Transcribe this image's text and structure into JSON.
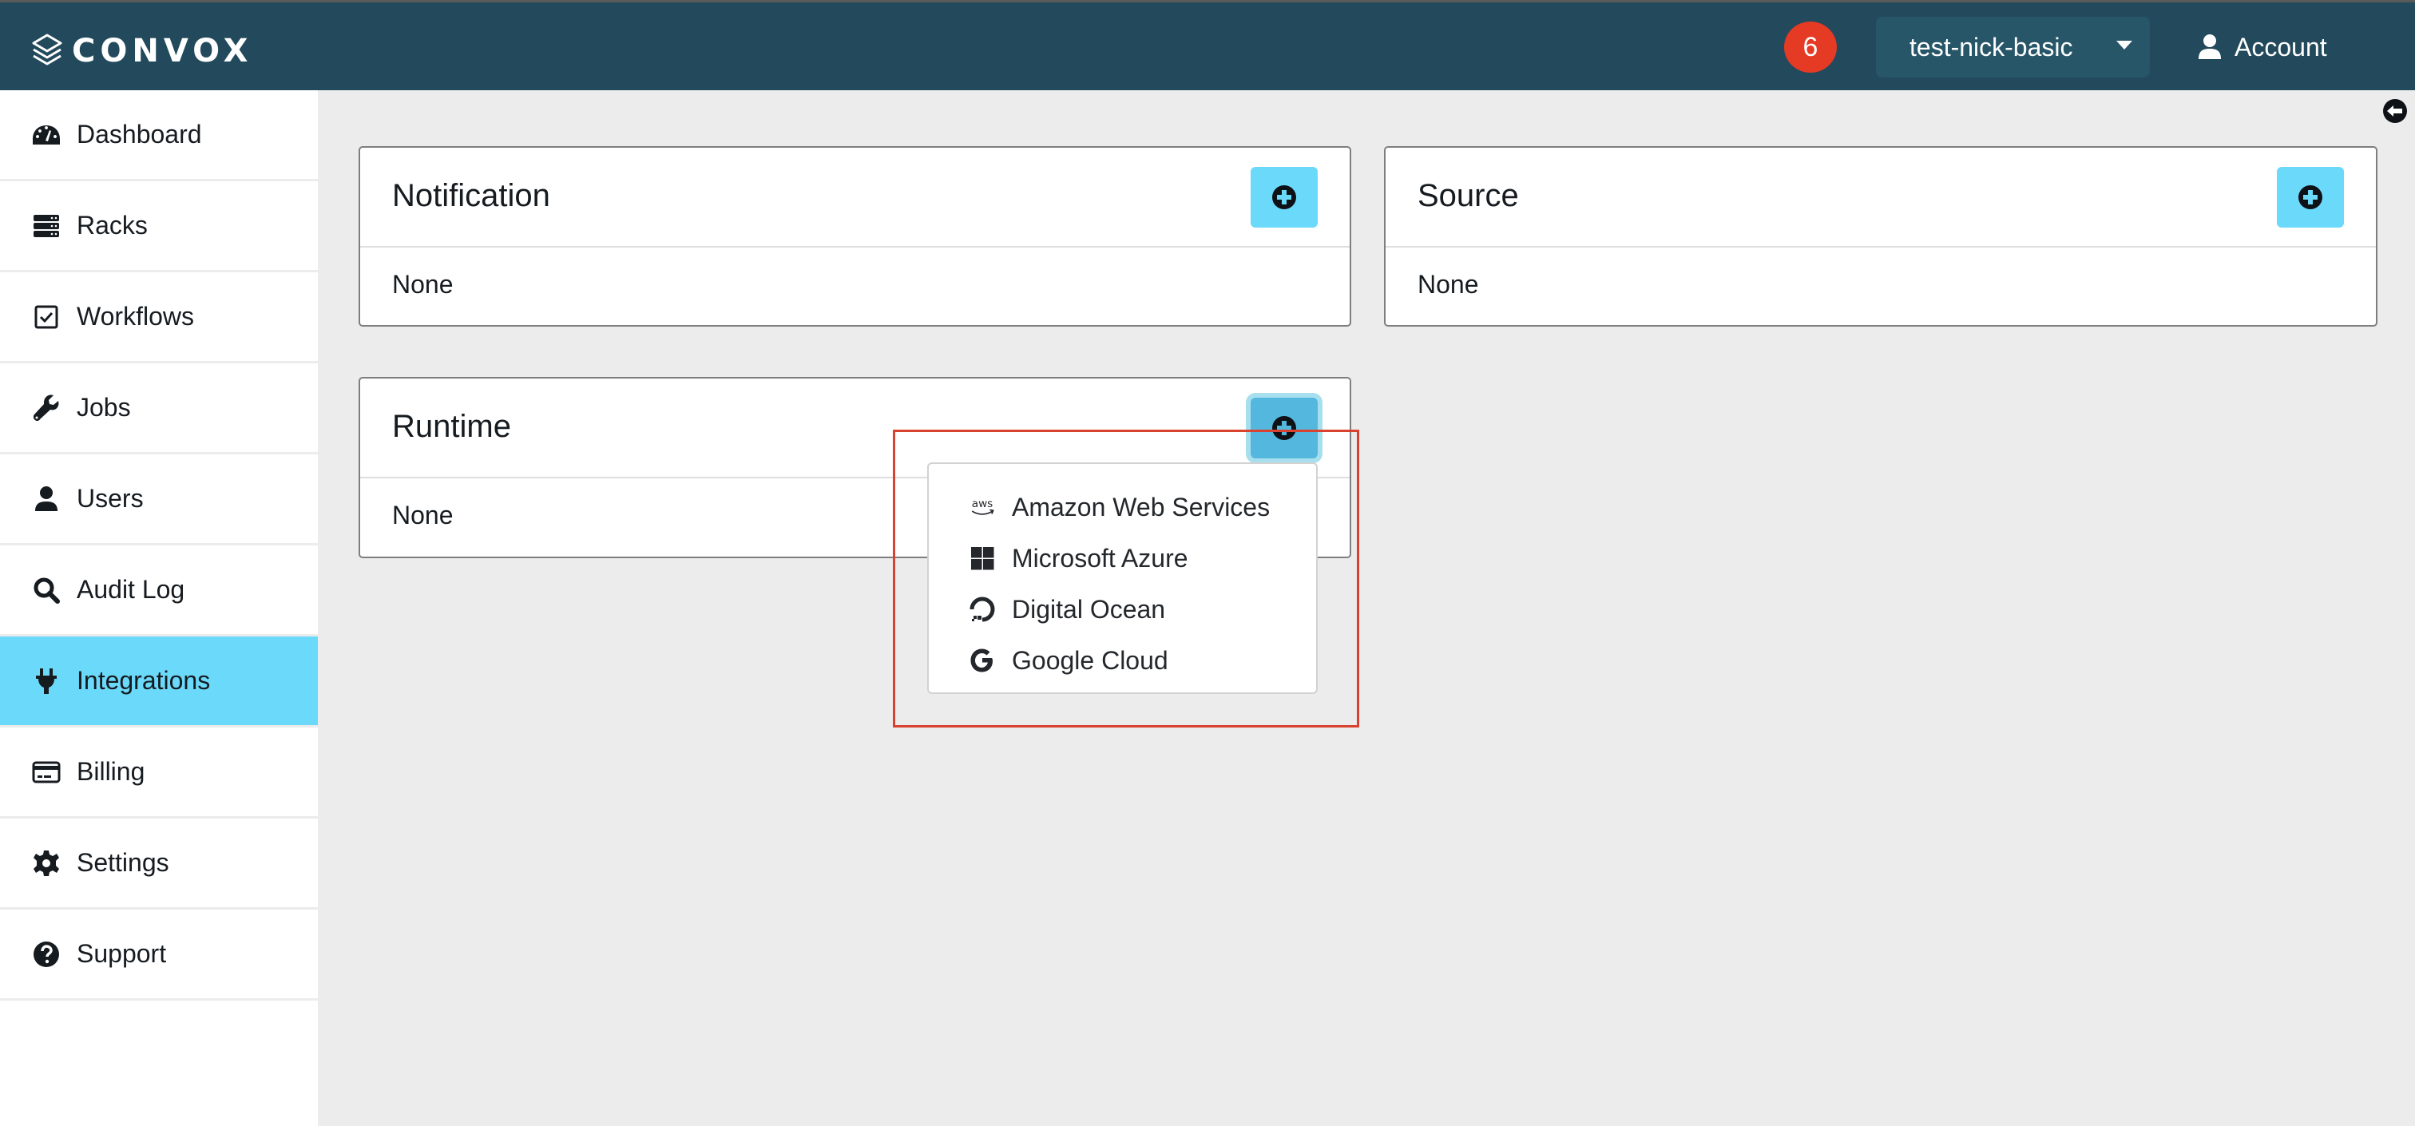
{
  "header": {
    "brand": "CONVOX",
    "notifications_count": "6",
    "rack_selector": "test-nick-basic",
    "account_label": "Account"
  },
  "sidebar": {
    "active": "Integrations",
    "items": [
      {
        "label": "Dashboard",
        "icon": "tachometer-icon"
      },
      {
        "label": "Racks",
        "icon": "server-icon"
      },
      {
        "label": "Workflows",
        "icon": "check-square-icon"
      },
      {
        "label": "Jobs",
        "icon": "wrench-icon"
      },
      {
        "label": "Users",
        "icon": "user-icon"
      },
      {
        "label": "Audit Log",
        "icon": "search-icon"
      },
      {
        "label": "Integrations",
        "icon": "plug-icon"
      },
      {
        "label": "Billing",
        "icon": "credit-card-icon"
      },
      {
        "label": "Settings",
        "icon": "gear-icon"
      },
      {
        "label": "Support",
        "icon": "question-circle-icon"
      }
    ]
  },
  "main": {
    "cards": [
      {
        "title": "Notification",
        "value": "None"
      },
      {
        "title": "Source",
        "value": "None"
      },
      {
        "title": "Runtime",
        "value": "None"
      }
    ],
    "runtime_menu": {
      "items": [
        {
          "label": "Amazon Web Services",
          "icon": "aws-icon"
        },
        {
          "label": "Microsoft Azure",
          "icon": "windows-icon"
        },
        {
          "label": "Digital Ocean",
          "icon": "digital-ocean-icon"
        },
        {
          "label": "Google Cloud",
          "icon": "google-icon"
        }
      ]
    }
  },
  "colors": {
    "header_bg": "#234a5c",
    "accent": "#6bd9fa",
    "badge": "#e53a23",
    "highlight": "#d8422e"
  }
}
